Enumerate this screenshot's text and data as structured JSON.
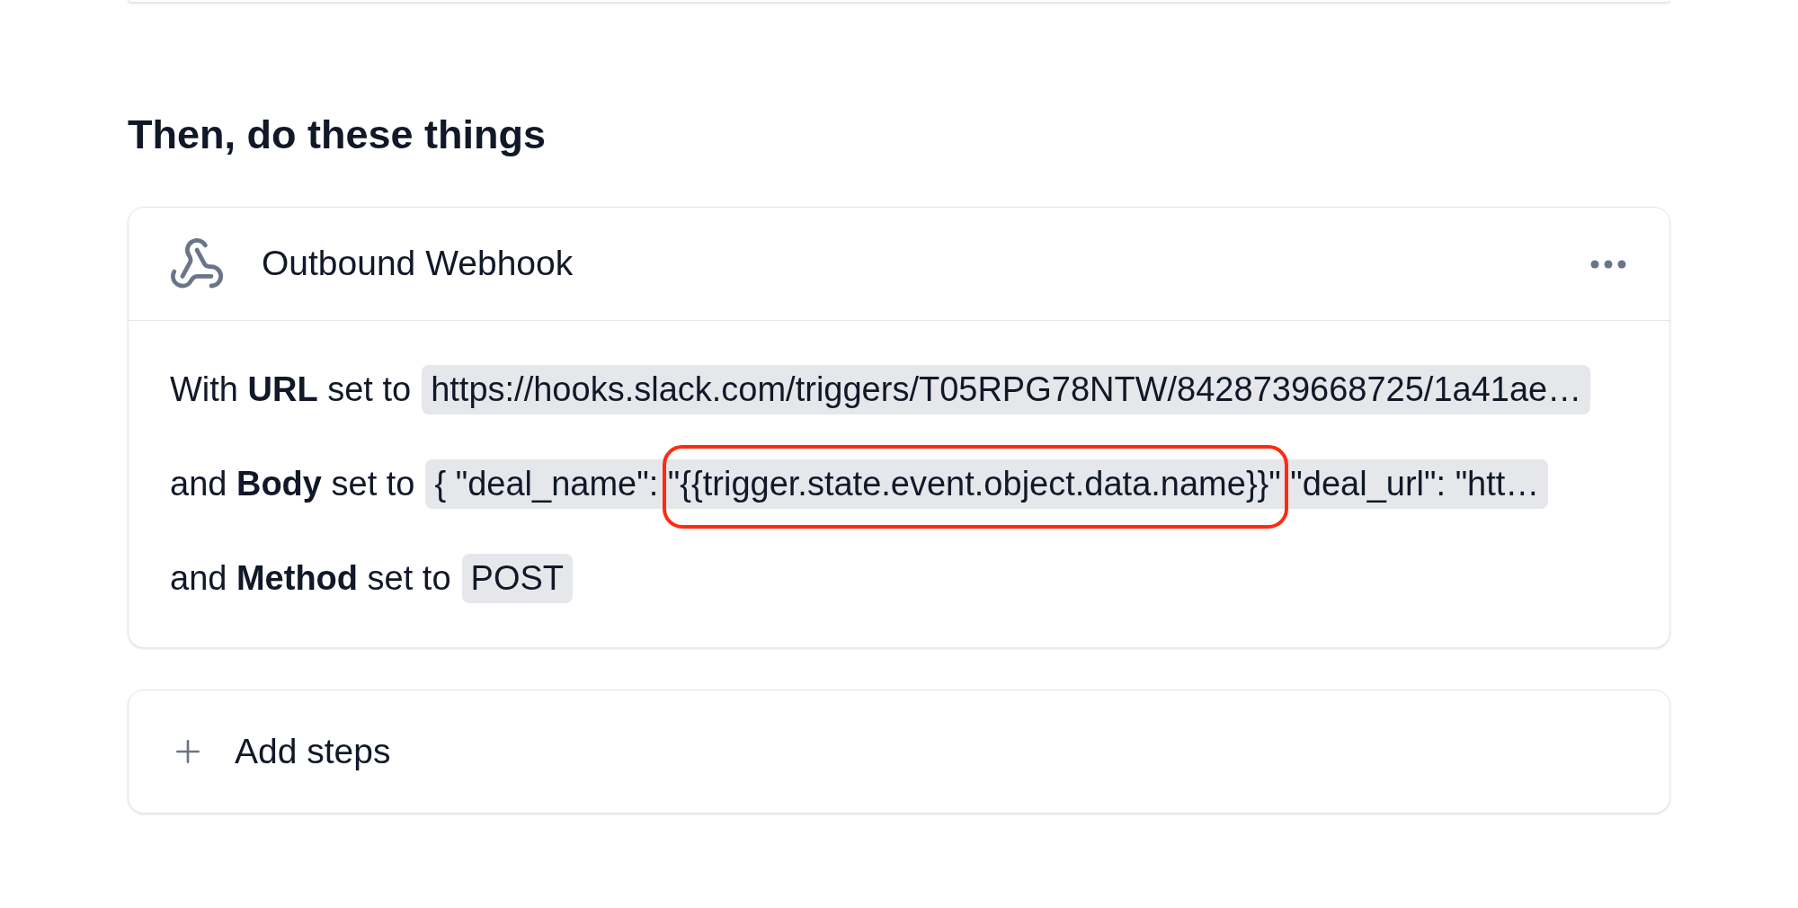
{
  "section": {
    "title": "Then, do these things"
  },
  "steps": [
    {
      "title": "Outbound Webhook",
      "fields": [
        {
          "label": "With **URL** set to",
          "value": [
            {
              "text": "https://hooks.slack.com/triggers/T05RPG78NTW/8428739668725/1a41ae…",
              "highlighted": false
            }
          ]
        },
        {
          "label": "and **Body** set to",
          "value": [
            {
              "text": "{ \"deal_name\": ",
              "highlighted": false
            },
            {
              "text": "\"{{trigger.state.event.object.data.name}}\"",
              "highlighted": true
            },
            {
              "text": " \"deal_url\": \"htt…",
              "highlighted": false
            }
          ]
        },
        {
          "label": "and **Method** set to",
          "value": [
            {
              "text": "POST",
              "highlighted": false
            }
          ]
        }
      ]
    }
  ],
  "add_steps": {
    "label": "Add steps"
  }
}
